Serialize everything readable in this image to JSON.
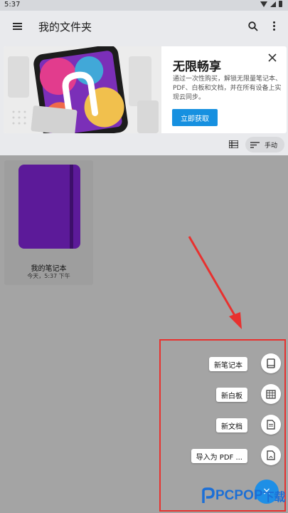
{
  "status_bar": {
    "time": "5:37"
  },
  "app_bar": {
    "title": "我的文件夹"
  },
  "promo": {
    "title": "无限畅享",
    "description": "通过一次性购买，解锁无限量笔记本、PDF、白板和文档，并在所有设备上实现云同步。",
    "button": "立即获取"
  },
  "toolbar": {
    "sort_label": "手动"
  },
  "notebook": {
    "name": "我的笔记本",
    "date": "今天，5:37 下午",
    "cover_color": "#5c1a99"
  },
  "fab_menu": {
    "items": [
      {
        "label": "新笔记本",
        "icon": "notebook-icon"
      },
      {
        "label": "新白板",
        "icon": "whiteboard-icon"
      },
      {
        "label": "新文档",
        "icon": "document-icon"
      },
      {
        "label": "导入为 PDF ...",
        "icon": "pdf-import-icon"
      }
    ],
    "close": "×"
  },
  "watermark": {
    "text": "PCPOP",
    "suffix": "下载"
  },
  "colors": {
    "accent": "#1690e0",
    "highlight": "#e8312f"
  }
}
